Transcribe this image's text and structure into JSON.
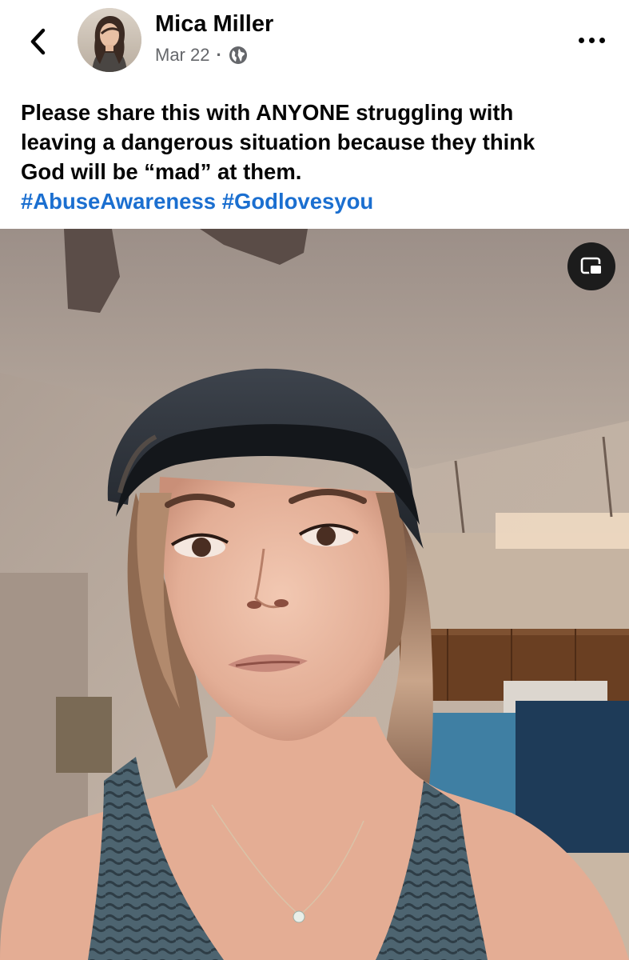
{
  "post": {
    "author": "Mica Miller",
    "date": "Mar 22",
    "separator": "·",
    "privacy_icon": "globe-icon"
  },
  "caption": {
    "lines": [
      "Please share this with ANYONE struggling with",
      "leaving a dangerous situation because they think",
      "God will be “mad” at them."
    ],
    "hashtags": [
      "#AbuseAwareness",
      "#Godlovesyou"
    ]
  },
  "icons": {
    "back": "chevron-left-icon",
    "more": "more-horizontal-icon",
    "pip": "picture-in-picture-icon"
  },
  "colors": {
    "text": "#050505",
    "secondary_text": "#65676b",
    "link": "#1b6fd0",
    "background": "#ffffff"
  }
}
